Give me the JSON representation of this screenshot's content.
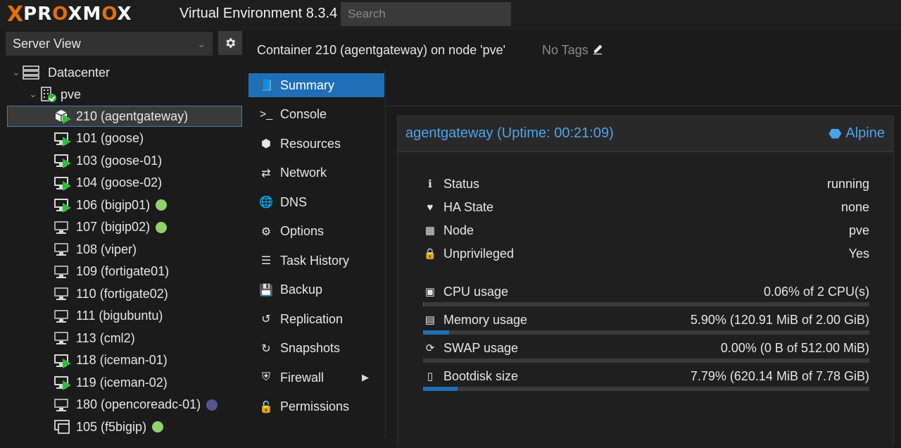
{
  "app": {
    "logo_x": "X",
    "logo_text_1": "PR",
    "logo_text_o1": "O",
    "logo_text_2": "XM",
    "logo_text_o2": "O",
    "logo_text_3": "X",
    "version": "Virtual Environment 8.3.4",
    "search_placeholder": "Search"
  },
  "sidebar": {
    "view": "Server View",
    "datacenter": "Datacenter",
    "node": "pve",
    "items": [
      {
        "label": "210 (agentgateway)",
        "kind": "container",
        "running": true,
        "selected": true,
        "dot": ""
      },
      {
        "label": "101 (goose)",
        "kind": "vm",
        "running": true,
        "dot": ""
      },
      {
        "label": "103 (goose-01)",
        "kind": "vm",
        "running": true,
        "dot": ""
      },
      {
        "label": "104 (goose-02)",
        "kind": "vm",
        "running": true,
        "dot": ""
      },
      {
        "label": "106 (bigip01)",
        "kind": "vm",
        "running": true,
        "dot": "green"
      },
      {
        "label": "107 (bigip02)",
        "kind": "vm",
        "running": false,
        "dot": "green"
      },
      {
        "label": "108 (viper)",
        "kind": "vm",
        "running": false,
        "dot": ""
      },
      {
        "label": "109 (fortigate01)",
        "kind": "vm",
        "running": false,
        "dot": ""
      },
      {
        "label": "110 (fortigate02)",
        "kind": "vm",
        "running": false,
        "dot": ""
      },
      {
        "label": "111 (bigubuntu)",
        "kind": "vm",
        "running": false,
        "dot": ""
      },
      {
        "label": "113 (cml2)",
        "kind": "vm",
        "running": false,
        "dot": ""
      },
      {
        "label": "118 (iceman-01)",
        "kind": "vm",
        "running": true,
        "dot": ""
      },
      {
        "label": "119 (iceman-02)",
        "kind": "vm",
        "running": true,
        "dot": ""
      },
      {
        "label": "180 (opencoreadc-01)",
        "kind": "vm",
        "running": false,
        "dot": "purple"
      },
      {
        "label": "105 (f5bigip)",
        "kind": "template",
        "running": false,
        "dot": "green"
      }
    ]
  },
  "header": {
    "title": "Container 210 (agentgateway) on node 'pve'",
    "tags": "No Tags"
  },
  "nav": [
    {
      "label": "Summary",
      "icon": "book-icon",
      "active": true
    },
    {
      "label": "Console",
      "icon": "terminal-icon"
    },
    {
      "label": "Resources",
      "icon": "cube-icon"
    },
    {
      "label": "Network",
      "icon": "exchange-icon"
    },
    {
      "label": "DNS",
      "icon": "globe-icon"
    },
    {
      "label": "Options",
      "icon": "gear-icon"
    },
    {
      "label": "Task History",
      "icon": "list-icon"
    },
    {
      "label": "Backup",
      "icon": "floppy-icon"
    },
    {
      "label": "Replication",
      "icon": "retweet-icon"
    },
    {
      "label": "Snapshots",
      "icon": "history-icon"
    },
    {
      "label": "Firewall",
      "icon": "shield-icon",
      "submenu": true
    },
    {
      "label": "Permissions",
      "icon": "unlock-icon"
    }
  ],
  "summary": {
    "title": "agentgateway (Uptime: 00:21:09)",
    "os": "Alpine",
    "status_label": "Status",
    "status_value": "running",
    "ha_label": "HA State",
    "ha_value": "none",
    "node_label": "Node",
    "node_value": "pve",
    "unpriv_label": "Unprivileged",
    "unpriv_value": "Yes",
    "cpu_label": "CPU usage",
    "cpu_value": "0.06% of 2 CPU(s)",
    "cpu_fraction": 0.0006,
    "mem_label": "Memory usage",
    "mem_value": "5.90% (120.91 MiB of 2.00 GiB)",
    "mem_fraction": 0.059,
    "swap_label": "SWAP usage",
    "swap_value": "0.00% (0 B of 512.00 MiB)",
    "swap_fraction": 0.0,
    "disk_label": "Bootdisk size",
    "disk_value": "7.79% (620.14 MiB of 7.78 GiB)",
    "disk_fraction": 0.0779
  },
  "colors": {
    "accent": "#1f6fb7",
    "link": "#4ea3e8",
    "brand_orange": "#e57000",
    "running_green": "#2fbd3b",
    "tag_green": "#8fd46b",
    "tag_purple": "#54568f"
  }
}
